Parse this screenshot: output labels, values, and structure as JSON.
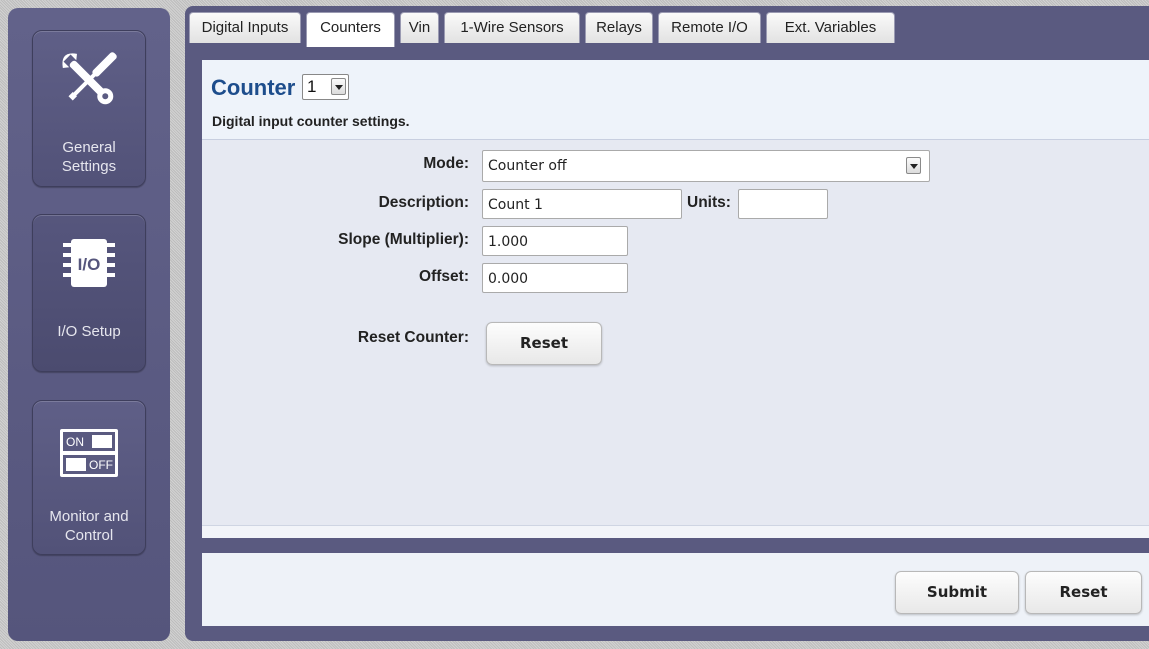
{
  "sidebar": {
    "items": [
      {
        "label_line1": "General",
        "label_line2": "Settings",
        "icon": "tools-icon"
      },
      {
        "label": "I/O Setup",
        "icon": "io-chip-icon",
        "icon_text": "I/O"
      },
      {
        "label_line1": "Monitor and",
        "label_line2": "Control",
        "icon": "on-off-switch-icon",
        "switch_on": "ON",
        "switch_off": "OFF"
      }
    ]
  },
  "tabs": [
    {
      "label": "Digital Inputs",
      "active": false
    },
    {
      "label": "Counters",
      "active": true
    },
    {
      "label": "Vin",
      "active": false
    },
    {
      "label": "1-Wire Sensors",
      "active": false
    },
    {
      "label": "Relays",
      "active": false
    },
    {
      "label": "Remote I/O",
      "active": false
    },
    {
      "label": "Ext. Variables",
      "active": false
    }
  ],
  "header": {
    "title": "Counter",
    "counter_selected": "1",
    "subtitle": "Digital input counter settings."
  },
  "form": {
    "mode_label": "Mode:",
    "mode_value": "Counter off",
    "description_label": "Description:",
    "description_value": "Count 1",
    "units_label": "Units:",
    "units_value": "",
    "slope_label": "Slope (Multiplier):",
    "slope_value": "1.000",
    "offset_label": "Offset:",
    "offset_value": "0.000",
    "reset_counter_label": "Reset Counter:",
    "reset_counter_button": "Reset"
  },
  "footer": {
    "submit_label": "Submit",
    "reset_label": "Reset"
  },
  "colors": {
    "sidebar": "#5a5a80",
    "title": "#1d4d8c",
    "panel": "#e6e9f2"
  }
}
